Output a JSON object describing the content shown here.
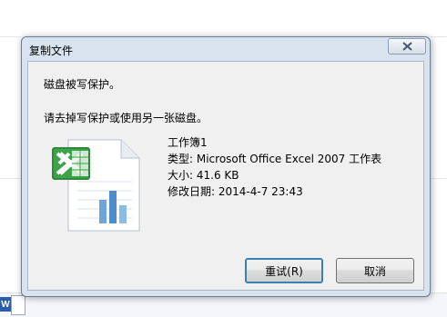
{
  "dialog": {
    "title": "复制文件",
    "message_primary": "磁盘被写保护。",
    "message_secondary": "请去掉写保护或使用另一张磁盘。"
  },
  "file": {
    "name": "工作簿1",
    "type_line": "类型: Microsoft Office Excel 2007 工作表",
    "size_line": "大小: 41.6 KB",
    "modified_line": "修改日期: 2014-4-7 23:43",
    "icon": "excel-file-icon"
  },
  "buttons": {
    "retry": "重试(R)",
    "cancel": "取消"
  },
  "background": {
    "taskbar_icon": "W"
  }
}
